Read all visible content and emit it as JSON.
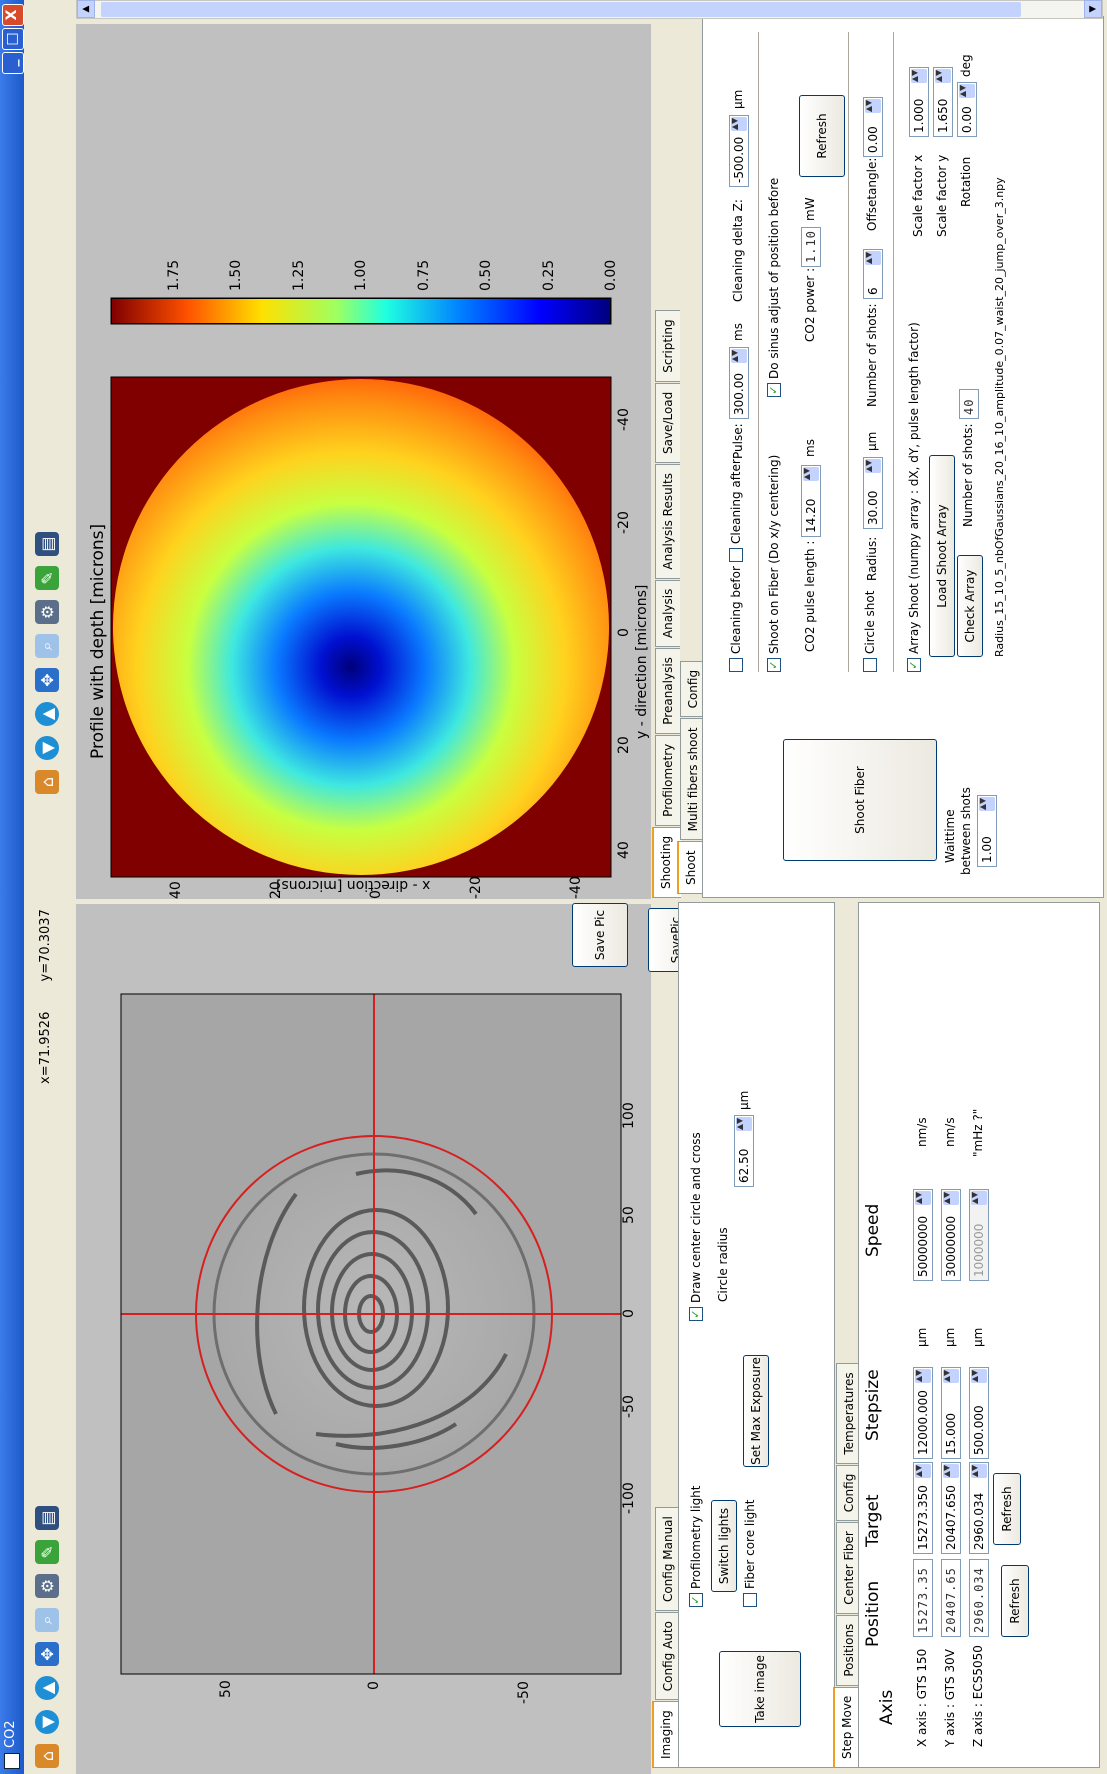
{
  "window": {
    "title": "CO2",
    "close": "X"
  },
  "coords": {
    "x": "x=71.9526",
    "y": "y=70.3037"
  },
  "left_image": {
    "x_ticks": [
      "-100",
      "-50",
      "0",
      "50",
      "100"
    ],
    "y_ticks": [
      "50",
      "0",
      "-50"
    ],
    "save_label": "SavePic"
  },
  "profile": {
    "title": "Profile with depth [microns]",
    "xlabel": "x - direction [microns]",
    "ylabel": "y - direction [microns]",
    "x_ticks": [
      "-40",
      "-20",
      "0",
      "20",
      "40"
    ],
    "y_ticks": [
      "40",
      "20",
      "0",
      "-20",
      "-40"
    ],
    "colorbar_ticks": [
      "1.75",
      "1.50",
      "1.25",
      "1.00",
      "0.75",
      "0.50",
      "0.25",
      "0.00"
    ],
    "save_label": "Save Pic"
  },
  "imaging_tabs": [
    "Imaging",
    "Config Auto",
    "Config Manual"
  ],
  "imaging": {
    "take_image": "Take image",
    "profilometry_light": "Profilometry light",
    "switch_lights": "Switch lights",
    "fiber_core_light": "Fiber core light",
    "set_max_exposure": "Set Max Exposure",
    "draw_center": "Draw center circle and cross",
    "circle_radius_label": "Circle radius",
    "circle_radius_value": "62.50",
    "circle_radius_unit": "µm"
  },
  "move_tabs": [
    "Step Move",
    "Positions",
    "Center Fiber",
    "Config",
    "Temperatures"
  ],
  "move": {
    "headers": {
      "axis": "Axis",
      "position": "Position",
      "target": "Target",
      "stepsize": "Stepsize",
      "speed": "Speed"
    },
    "rows": [
      {
        "axis": "X axis : GTS 150",
        "position": "15273.35",
        "target": "15273.350",
        "stepsize": "12000.000",
        "unit": "µm",
        "speed": "50000000",
        "speed_unit": "nm/s"
      },
      {
        "axis": "Y axis : GTS 30V",
        "position": "20407.65",
        "target": "20407.650",
        "stepsize": "15.000",
        "unit": "µm",
        "speed": "30000000",
        "speed_unit": "nm/s"
      },
      {
        "axis": "Z axis : ECS5050",
        "position": "2960.034",
        "target": "2960.034",
        "stepsize": "500.000",
        "unit": "µm",
        "speed": "1000000",
        "speed_unit": "\"mHz ?\""
      }
    ],
    "refresh1": "Refresh",
    "refresh2": "Refresh"
  },
  "main_tabs": [
    "Shooting",
    "Profilometry",
    "Preanalysis",
    "Analysis",
    "Analysis Results",
    "Save/Load",
    "Scripting"
  ],
  "sub_tabs": [
    "Shoot",
    "Multi fibers shoot",
    "Config"
  ],
  "shoot": {
    "shoot_fiber": "Shoot Fiber",
    "waittime_label_1": "Waittime",
    "waittime_label_2": "between shots",
    "waittime_value": "1.00",
    "cleaning_before": "Cleaning befor",
    "cleaning_after": "Cleaning after",
    "pulse_label": "Pulse:",
    "pulse_value": "300.00",
    "pulse_unit": "ms",
    "cleaning_delta_label": "Cleaning delta Z:",
    "cleaning_delta_value": "-500.00",
    "cleaning_delta_unit": "µm",
    "shoot_on_fiber": "Shoot on Fiber (Do x/y centering)",
    "sinus_adjust": "Do sinus adjust of position before",
    "co2_pulse_label": "CO2 pulse length :",
    "co2_pulse_value": "14.20",
    "co2_pulse_unit": "ms",
    "co2_power_label": "CO2 power :",
    "co2_power_value": "1.10",
    "co2_power_unit": "mW",
    "refresh": "Refresh",
    "circle_shot": "Circle shot",
    "radius_label": "Radius:",
    "radius_value": "30.00",
    "radius_unit": "µm",
    "nshots_label": "Number of shots:",
    "nshots_value": "6",
    "offset_label": "Offsetangle:",
    "offset_value": "0.00",
    "array_shoot": "Array Shoot (numpy array : dX, dY,  pulse length factor)",
    "load_array": "Load Shoot Array",
    "check_array": "Check Array",
    "array_nshots_label": "Number of shots:",
    "array_nshots_value": "40",
    "scale_x_label": "Scale factor x",
    "scale_x_value": "1.000",
    "scale_y_label": "Scale factor y",
    "scale_y_value": "1.650",
    "rotation_label": "Rotation",
    "rotation_value": "0.00",
    "rotation_unit": "deg",
    "filename": "Radius_15_10_5_nbOfGaussians_20_16_10_amplitude_0.07_waist_20_jump_over_3.npy"
  }
}
